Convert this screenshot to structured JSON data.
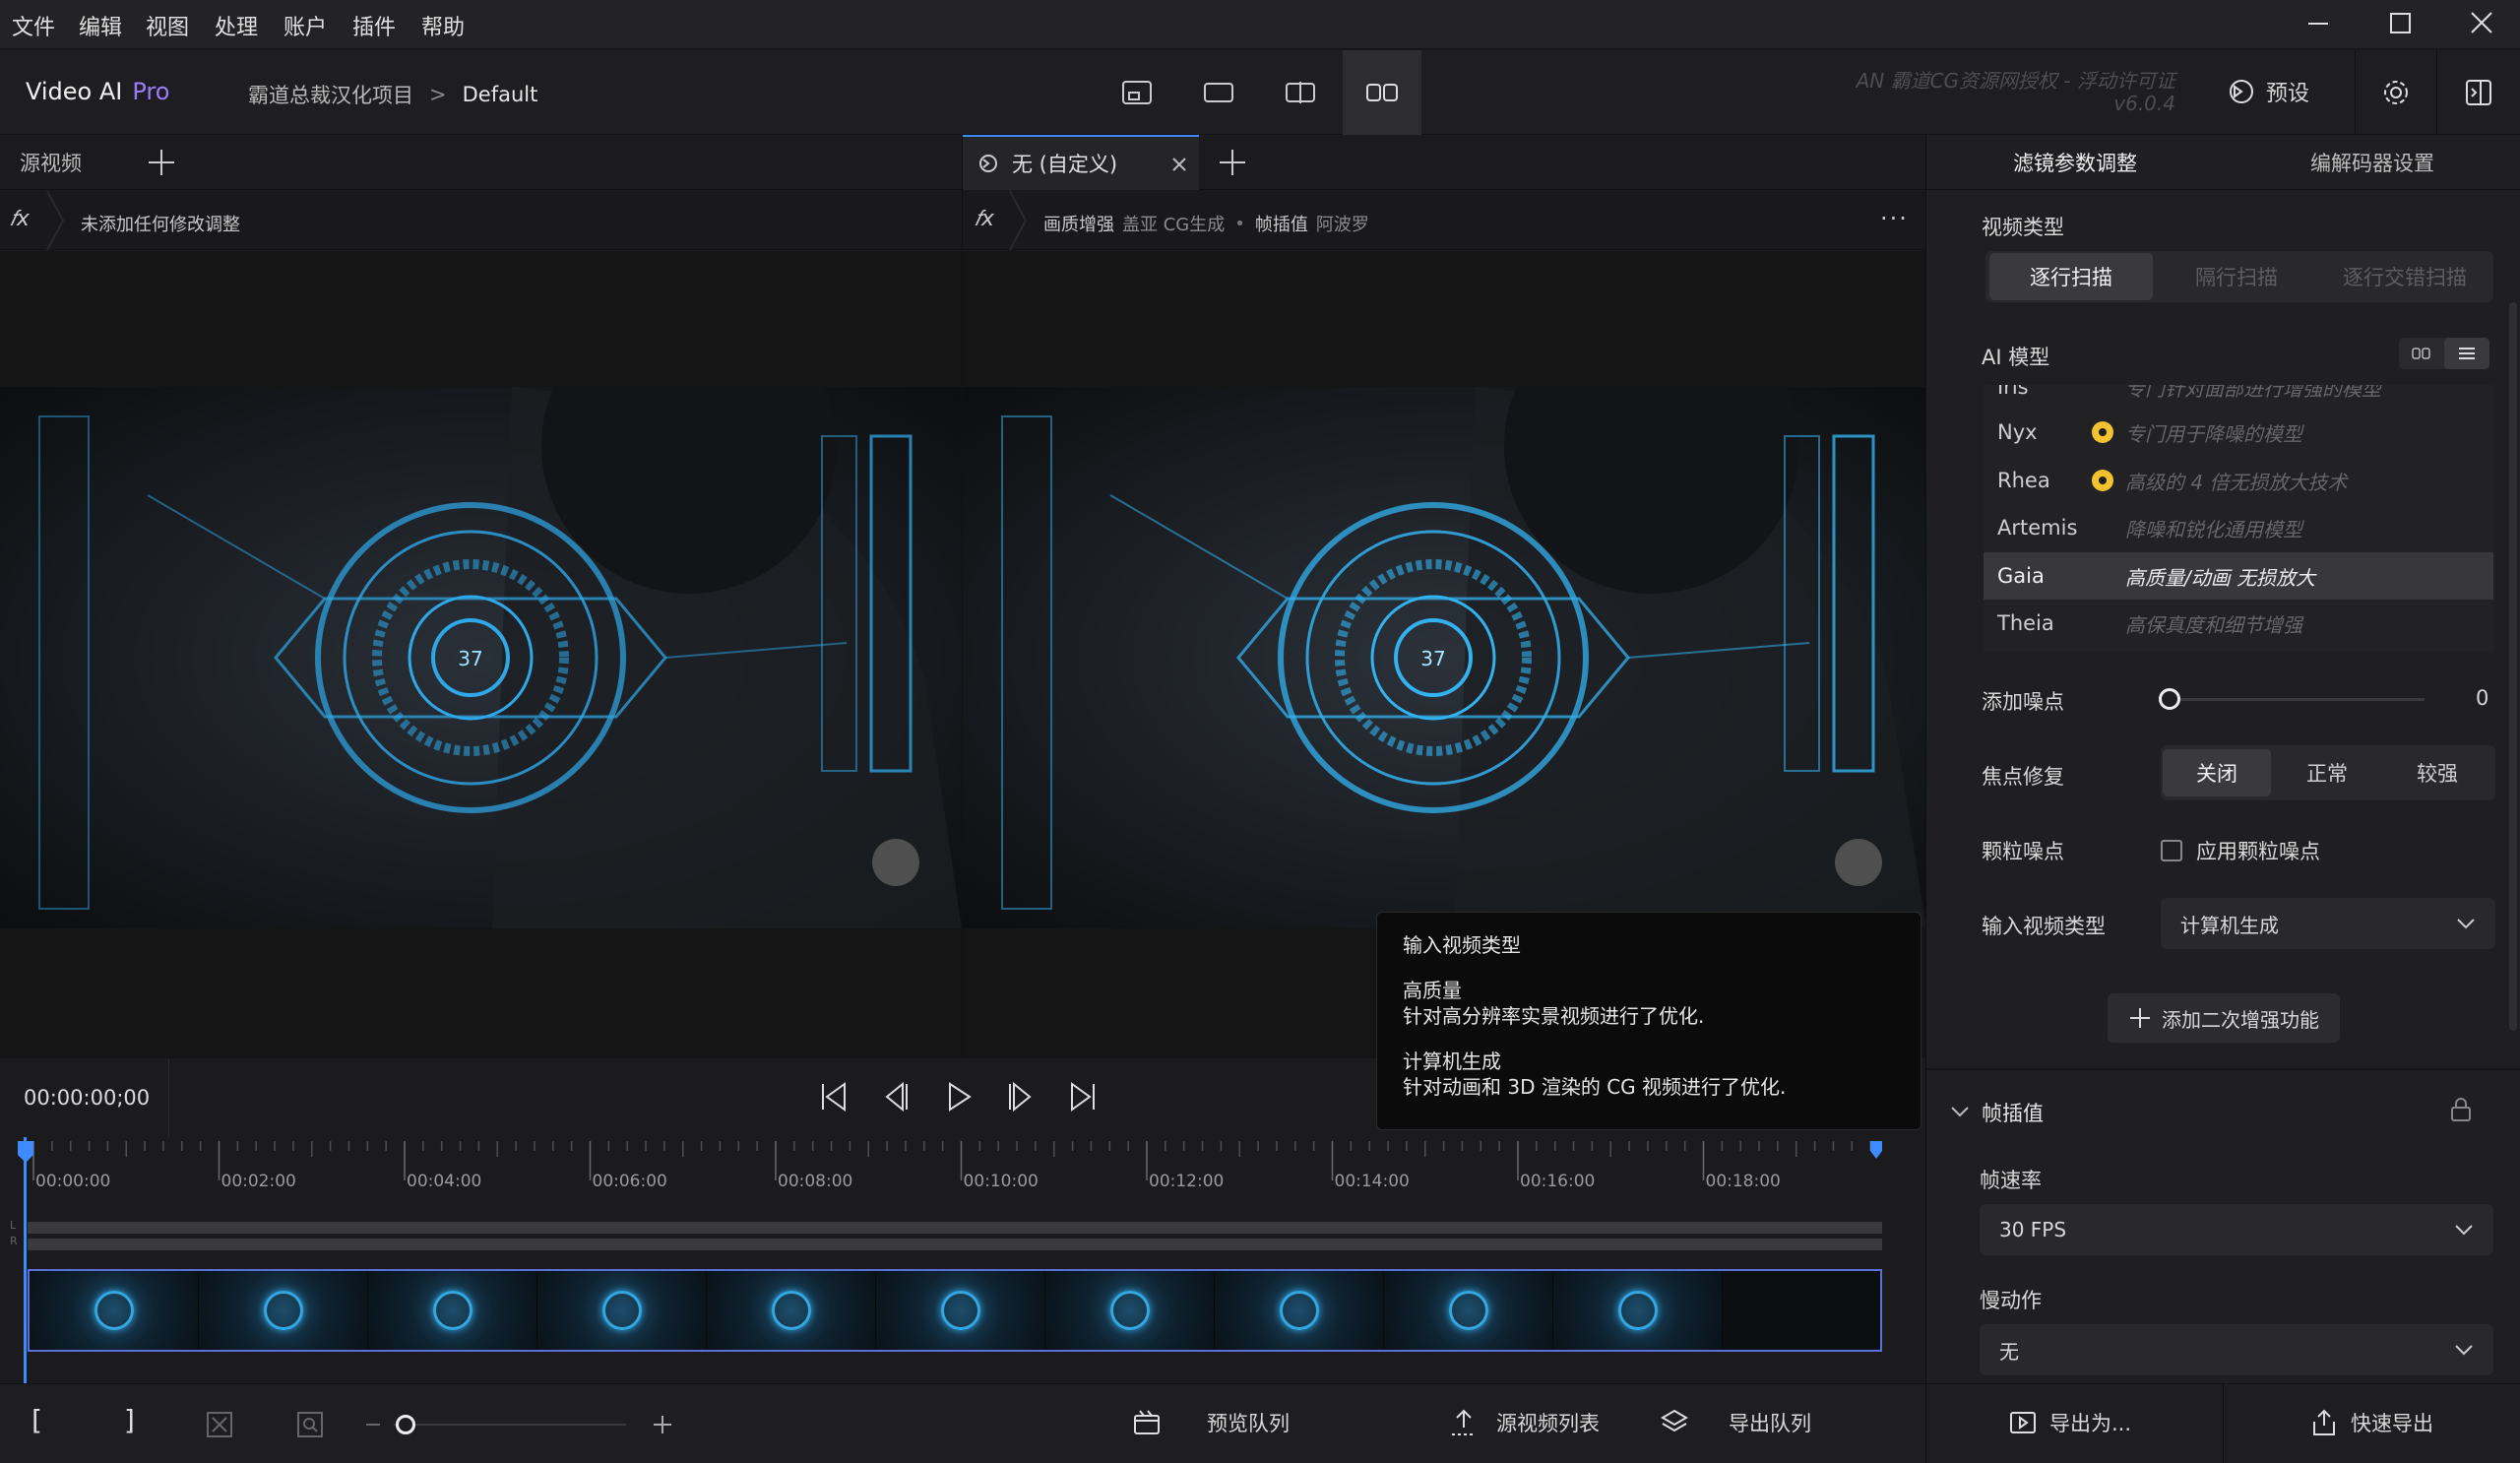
{
  "menu": [
    "文件",
    "编辑",
    "视图",
    "处理",
    "账户",
    "插件",
    "帮助"
  ],
  "app": {
    "name": "Video AI",
    "edition": "Pro"
  },
  "breadcrumb": {
    "project": "霸道总裁汉化项目",
    "separator": ">",
    "preset": "Default"
  },
  "license": {
    "line1": "AN  霸道CG资源网授权 - 浮动许可证",
    "version": "v6.0.4"
  },
  "header_buttons": {
    "presets": "预设"
  },
  "source_tab": {
    "label": "源视频"
  },
  "output_tab": {
    "label": "无  (自定义)"
  },
  "source_fx": {
    "text": "未添加任何修改调整"
  },
  "output_fx": {
    "enhance": "画质增强",
    "enhance_model": "盖亚 CG生成",
    "dot": "•",
    "interp": "帧插值",
    "interp_model": "阿波罗"
  },
  "hud_number": "37",
  "timecode": "00:00:00;00",
  "timeline": {
    "ticks": [
      "00:00:00",
      "00:02:00",
      "00:04:00",
      "00:06:00",
      "00:08:00",
      "00:10:00",
      "00:12:00",
      "00:14:00",
      "00:16:00",
      "00:18:00"
    ],
    "lr": [
      "L",
      "R"
    ]
  },
  "tooltip": {
    "title": "输入视频类型",
    "h1": "高质量",
    "d1": "针对高分辨率实景视频进行了优化.",
    "h2": "计算机生成",
    "d2": "针对动画和 3D 渲染的 CG 视频进行了优化."
  },
  "right_tabs": {
    "filters": "滤镜参数调整",
    "codec": "编解码器设置"
  },
  "video_type": {
    "label": "视频类型",
    "options": [
      "逐行扫描",
      "隔行扫描",
      "逐行交错扫描"
    ],
    "selected": 0
  },
  "ai_model": {
    "label": "AI 模型",
    "models": [
      {
        "name": "Iris",
        "desc": "专门针对面部进行增强的模型",
        "star": false
      },
      {
        "name": "Nyx",
        "desc": "专门用于降噪的模型",
        "star": true
      },
      {
        "name": "Rhea",
        "desc": "高级的 4 倍无损放大技术",
        "star": true
      },
      {
        "name": "Artemis",
        "desc": "降噪和锐化通用模型",
        "star": false
      },
      {
        "name": "Gaia",
        "desc": "高质量/动画 无损放大",
        "star": false,
        "selected": true
      },
      {
        "name": "Theia",
        "desc": "高保真度和细节增强",
        "star": false
      }
    ]
  },
  "add_noise": {
    "label": "添加噪点",
    "value": "0",
    "level": 0
  },
  "focus_fix": {
    "label": "焦点修复",
    "options": [
      "关闭",
      "正常",
      "较强"
    ],
    "selected": 0
  },
  "grain": {
    "label": "颗粒噪点",
    "checkbox": "应用颗粒噪点",
    "checked": false
  },
  "input_type": {
    "label": "输入视频类型",
    "value": "计算机生成"
  },
  "add_secondary": "添加二次增强功能",
  "frame_interp": {
    "label": "帧插值"
  },
  "frame_rate": {
    "label": "帧速率",
    "value": "30 FPS"
  },
  "slow_motion": {
    "label": "慢动作",
    "value": "无"
  },
  "bottom": {
    "preview_queue": "预览队列",
    "source_list": "源视频列表",
    "export_queue": "导出队列",
    "export_as": "导出为...",
    "quick_export": "快速导出"
  },
  "colors": {
    "accent": "#3d8bff",
    "pro": "#9b7bff",
    "hud": "#2fa8e8",
    "star": "#f2c230"
  }
}
